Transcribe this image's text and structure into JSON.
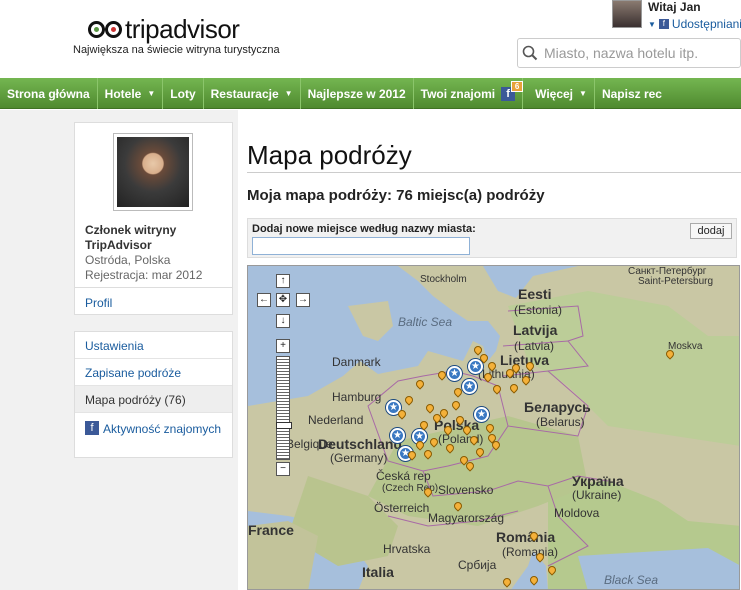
{
  "header": {
    "logo_text": "tripadvisor",
    "tagline": "Największa na świecie witryna turystyczna",
    "user_greeting": "Witaj Jan",
    "share_label": "Udostępnianie",
    "search_placeholder": "Miasto, nazwa hotelu itp."
  },
  "nav": {
    "items": [
      {
        "label": "Strona główna"
      },
      {
        "label": "Hotele"
      },
      {
        "label": "Loty"
      },
      {
        "label": "Restauracje"
      },
      {
        "label": "Najlepsze w 2012"
      },
      {
        "label": "Twoi znajomi"
      },
      {
        "label": "Więcej"
      },
      {
        "label": "Napisz rec"
      }
    ],
    "friends_badge": "6"
  },
  "sidebar": {
    "member_title": "Członek witryny TripAdvisor",
    "location": "Ostróda, Polska",
    "registered": "Rejestracja: mar 2012",
    "profile_link": "Profil",
    "menu": [
      {
        "label": "Ustawienia"
      },
      {
        "label": "Zapisane podróże"
      },
      {
        "label": "Mapa podróży (76)"
      },
      {
        "label": "Aktywność znajomych"
      }
    ]
  },
  "main": {
    "title": "Mapa podróży",
    "subtitle": "Moja mapa podróży: 76 miejsc(a) podróży",
    "add_label": "Dodaj nowe miejsce według nazwy miasta:",
    "add_button": "dodaj"
  },
  "map": {
    "labels": {
      "eesti": "Eesti",
      "estonia": "(Estonia)",
      "stpete": "Санкт-Петербург",
      "stpete_en": "Saint-Petersburg",
      "stockholm": "Stockholm",
      "latvija": "Latvija",
      "latvia": "(Latvia)",
      "balticsea": "Baltic Sea",
      "lietuva": "Lietuva",
      "lithuania": "(Lithuania)",
      "danmark": "Danmark",
      "hamburg": "Hamburg",
      "nederland": "Nederland",
      "deutschland": "Deutschland",
      "germany": "(Germany)",
      "polska": "Polska",
      "poland": "(Poland)",
      "belarus": "Беларусь",
      "belarus_en": "(Belarus)",
      "moskva": "Moskva",
      "belgique": "Belgique",
      "ceska": "Česká rep",
      "czech": "(Czech Rep)",
      "slovensko": "Slovensko",
      "ukraina": "Україна",
      "ukraine": "(Ukraine)",
      "france": "France",
      "osterreich": "Österreich",
      "magyar": "Magyarország",
      "moldova": "Moldova",
      "romania": "România",
      "romania_en": "(Romania)",
      "hrvatska": "Hrvatska",
      "srbija": "Србија",
      "italia": "Italia",
      "blacksea": "Black Sea"
    }
  }
}
